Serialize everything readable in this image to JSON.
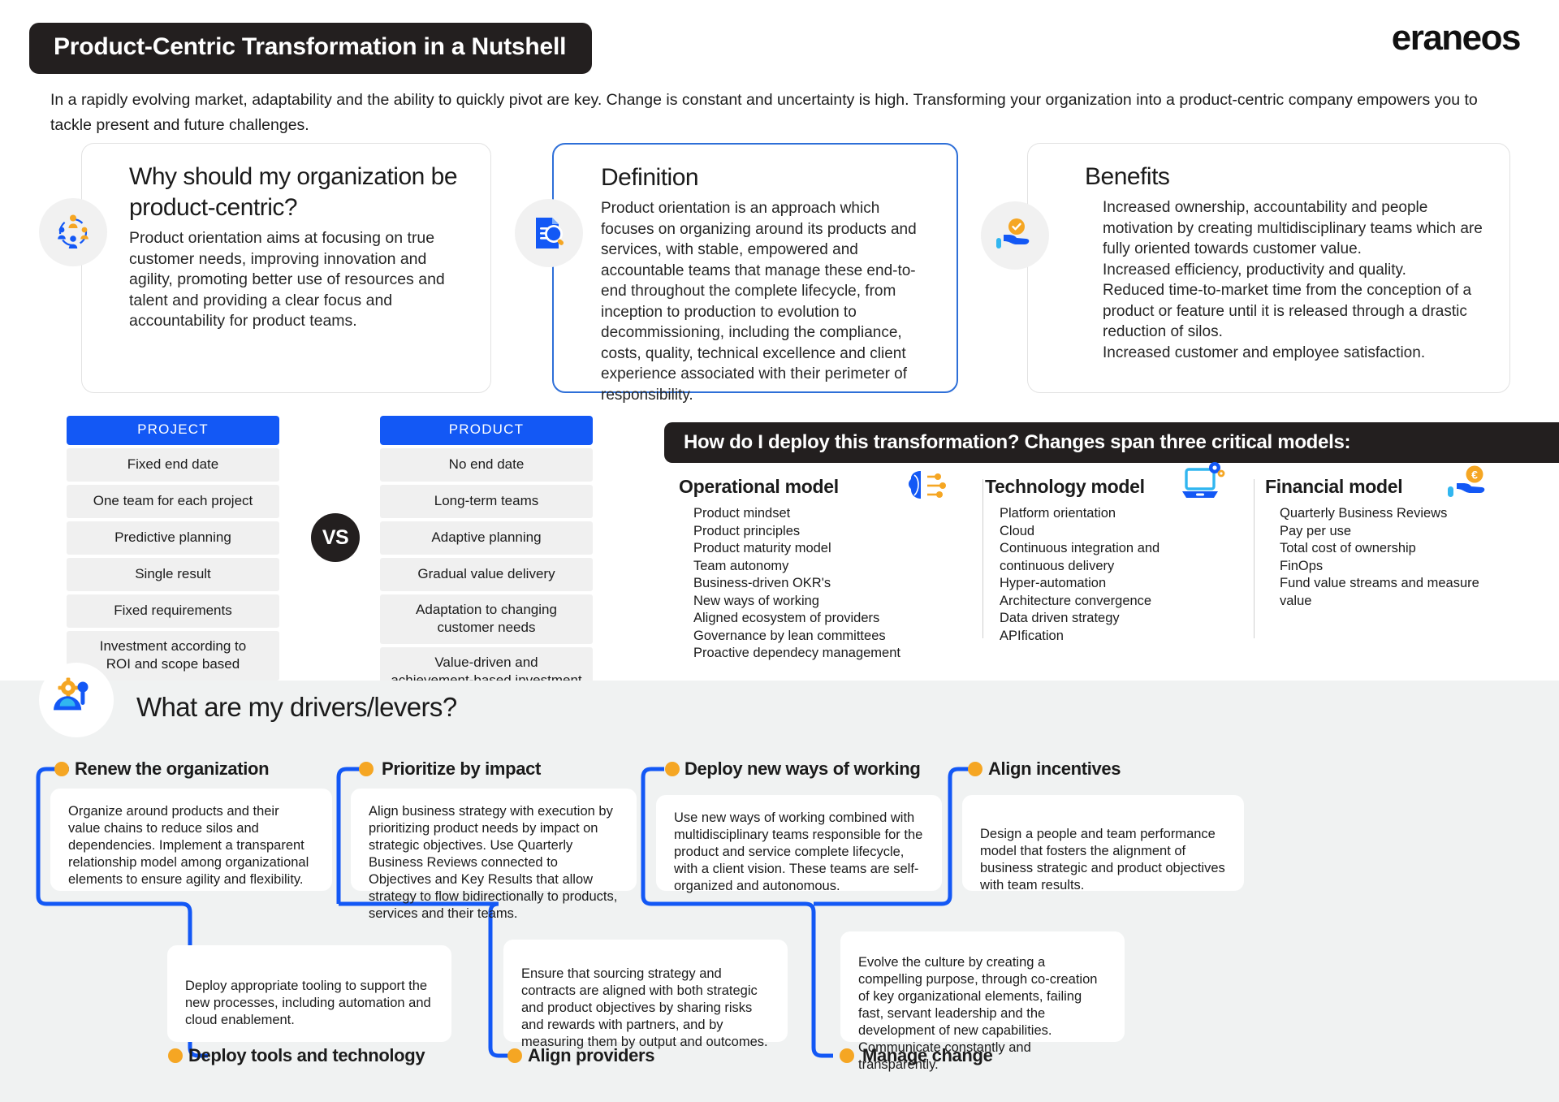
{
  "header": {
    "title": "Product-Centric Transformation in a Nutshell",
    "brand": "eraneos",
    "intro": "In a rapidly evolving market, adaptability and the ability to quickly pivot are key. Change is constant and uncertainty is high. Transforming your organization into a product-centric company empowers you to tackle present and future challenges."
  },
  "cards": [
    {
      "heading": "Why should my organization be product-centric?",
      "body": "Product orientation aims at focusing on true customer needs, improving innovation and agility, promoting better use of resources and talent and providing a clear focus and accountability for product teams.",
      "icon": "people-network-icon"
    },
    {
      "heading": "Definition",
      "body": "Product orientation is an approach which focuses on organizing around its products and services, with stable, empowered and accountable teams that manage these end-to-end throughout the complete lifecycle, from inception to production to evolution to decommissioning, including the compliance, costs, quality, technical excellence and client experience associated with their perimeter of responsibility.",
      "icon": "document-search-icon"
    },
    {
      "heading": "Benefits",
      "body": "Increased ownership, accountability and people motivation by creating multidisciplinary teams which are fully oriented towards customer value.\nIncreased efficiency, productivity and quality.\nReduced time-to-market time from the conception of a product or feature until it is released through a drastic reduction of silos.\nIncreased customer and employee satisfaction.",
      "icon": "hand-check-icon"
    }
  ],
  "comparison": {
    "vs_label": "VS",
    "left": {
      "header": "PROJECT",
      "rows": [
        "Fixed end date",
        "One team for each project",
        "Predictive planning",
        "Single result",
        "Fixed requirements",
        "Investment according to\nROI and scope based"
      ]
    },
    "right": {
      "header": "PRODUCT",
      "rows": [
        "No end date",
        "Long-term teams",
        "Adaptive planning",
        "Gradual value delivery",
        "Adaptation to changing\ncustomer needs",
        "Value-driven and\nachievement-based investment"
      ]
    }
  },
  "models": {
    "banner": "How do I deploy this transformation? Changes span three critical models:",
    "columns": [
      {
        "title": "Operational model",
        "icon": "brain-circuit-icon",
        "items": [
          "Product mindset",
          "Product principles",
          "Product maturity model",
          "Team autonomy",
          "Business-driven OKR's",
          "New ways of working",
          "Aligned ecosystem of providers",
          "Governance by lean committees",
          "Proactive dependecy management"
        ]
      },
      {
        "title": "Technology model",
        "icon": "laptop-gear-icon",
        "items": [
          "Platform orientation",
          "Cloud",
          "Continuous integration and",
          "continuous delivery",
          "Hyper-automation",
          "Architecture convergence",
          "Data driven strategy",
          "APIfication"
        ]
      },
      {
        "title": "Financial model",
        "icon": "hand-euro-icon",
        "items": [
          "Quarterly Business Reviews",
          "Pay per use",
          "Total cost of ownership",
          "FinOps",
          "Fund value streams and measure",
          "value"
        ]
      }
    ]
  },
  "levers": {
    "title": "What are my drivers/levers?",
    "icon": "gear-person-icon",
    "items": [
      {
        "label": "Renew the organization",
        "text": "Organize around products and their value chains to reduce silos and dependencies. Implement a transparent relationship model among organizational elements to ensure agility and flexibility."
      },
      {
        "label": "Prioritize by impact",
        "text": "Align business strategy with execution by prioritizing product needs by impact on strategic objectives. Use Quarterly Business Reviews connected to Objectives and Key Results that allow strategy to flow bidirectionally to products, services and their teams."
      },
      {
        "label": "Deploy new ways of working",
        "text": "Use new ways of working combined with multidisciplinary teams responsible for the product and service complete lifecycle, with a client vision. These teams are self-organized and autonomous."
      },
      {
        "label": "Align incentives",
        "text": "Design a people and team performance model that fosters the alignment of business strategic and product objectives with team results."
      },
      {
        "label": "Deploy tools and technology",
        "text": "Deploy appropriate tooling to support the new processes, including automation and cloud enablement."
      },
      {
        "label": "Align providers",
        "text": "Ensure that sourcing strategy and contracts are aligned with both strategic and product objectives by sharing risks and rewards with partners, and by measuring them by output and outcomes."
      },
      {
        "label": "Manage change",
        "text": "Evolve the culture by creating a compelling purpose, through co-creation of key organizational elements, failing fast, servant leadership and the development of new capabilities. Communicate constantly and transparently."
      }
    ]
  },
  "colors": {
    "accent_blue": "#1358f5",
    "accent_orange": "#f5a623",
    "dark": "#231f1f",
    "panel_bg": "#f0f2f2",
    "cell_bg": "#f0f0f0"
  }
}
